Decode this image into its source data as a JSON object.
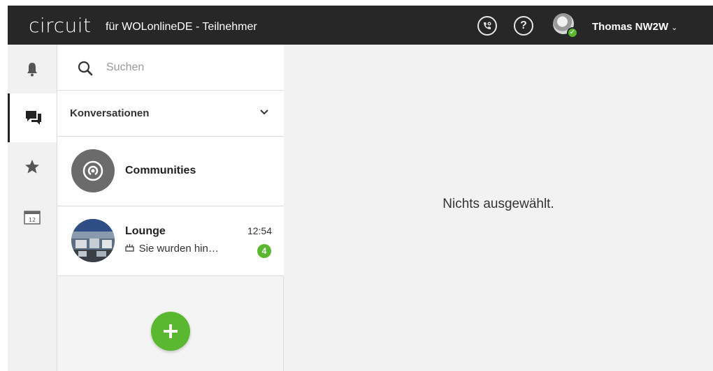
{
  "header": {
    "brand": "circuit",
    "tenant": "für WOLonlineDE - Teilnehmer",
    "user_name": "Thomas NW2W",
    "caret": "⌄",
    "help_glyph": "?"
  },
  "rail": {
    "items": [
      {
        "name": "notifications",
        "icon": "bell-icon"
      },
      {
        "name": "conversations",
        "icon": "chat-bubbles-icon",
        "active": true
      },
      {
        "name": "favorites",
        "icon": "star-icon"
      },
      {
        "name": "calendar",
        "icon": "calendar-icon",
        "day": "12"
      }
    ]
  },
  "search": {
    "placeholder": "Suchen"
  },
  "section": {
    "label": "Konversationen"
  },
  "conversations": [
    {
      "title": "Communities",
      "icon": "communities-broadcast-icon"
    },
    {
      "title": "Lounge",
      "time": "12:54",
      "preview": "Sie wurden hin…",
      "unread": "4",
      "preview_icon": "cake-icon"
    }
  ],
  "content": {
    "empty_text": "Nichts ausgewählt."
  },
  "colors": {
    "topbar": "#272727",
    "accent_green": "#59b82f",
    "rail_bg": "#f1f1f1",
    "content_bg": "#f2f2f2"
  }
}
